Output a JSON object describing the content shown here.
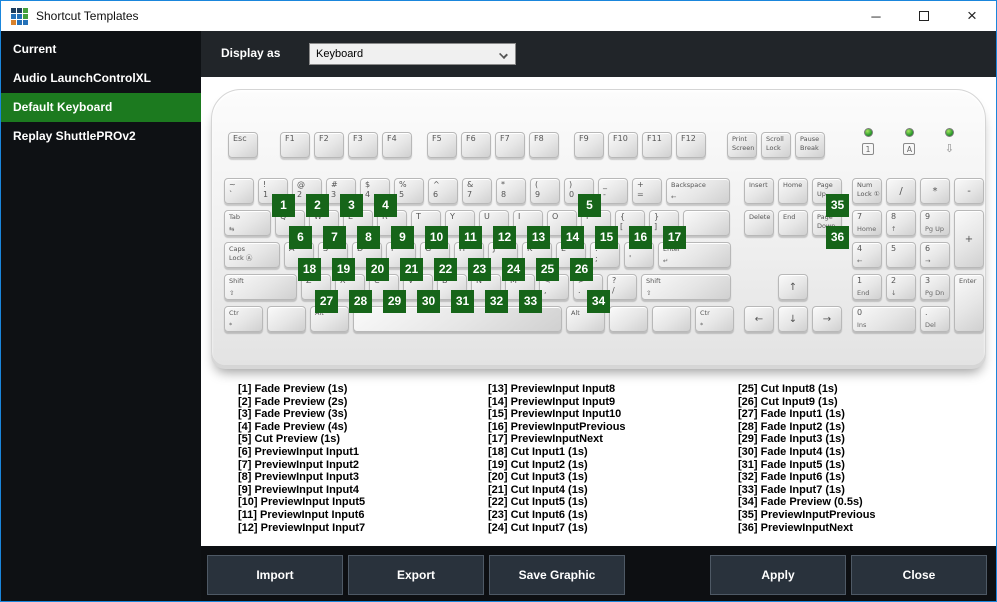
{
  "window": {
    "title": "Shortcut Templates",
    "icon_colors": [
      "#1d3e5f",
      "#1d3e5f",
      "#44a03c",
      "#2471b8",
      "#2471b8",
      "#44a03c",
      "#d9822b",
      "#2471b8",
      "#2471b8"
    ],
    "controls": {
      "minimize": "─",
      "close": "×"
    }
  },
  "colors": {
    "selection_green": "#1c7a1f",
    "badge_green": "#166519",
    "window_border": "#1a86dc"
  },
  "sidebar": {
    "items": [
      {
        "label": "Current",
        "selected": false
      },
      {
        "label": "Audio LaunchControlXL",
        "selected": false
      },
      {
        "label": "Default Keyboard",
        "selected": true
      },
      {
        "label": "Replay ShuttlePROv2",
        "selected": false
      }
    ]
  },
  "toolbar": {
    "display_as_label": "Display as",
    "display_as_value": "Keyboard"
  },
  "keyboard": {
    "function_row": [
      {
        "t": "Esc"
      },
      {
        "sp": 18
      },
      {
        "t": "F1"
      },
      {
        "t": "F2"
      },
      {
        "t": "F3"
      },
      {
        "t": "F4"
      },
      {
        "sp": 11
      },
      {
        "t": "F5"
      },
      {
        "t": "F6"
      },
      {
        "t": "F7"
      },
      {
        "t": "F8"
      },
      {
        "sp": 11
      },
      {
        "t": "F9"
      },
      {
        "t": "F10"
      },
      {
        "t": "F11"
      },
      {
        "t": "F12"
      },
      {
        "sp": 17
      },
      {
        "t": "Print",
        "b": "Screen",
        "cls": "sm"
      },
      {
        "t": "Scroll",
        "b": "Lock",
        "cls": "sm"
      },
      {
        "t": "Pause",
        "b": "Break",
        "cls": "sm"
      }
    ],
    "leds": [
      {
        "label": "1",
        "box": true,
        "name": "num-lock-led"
      },
      {
        "label": "A",
        "box": true,
        "name": "caps-lock-led"
      },
      {
        "label": "⇩",
        "box": false,
        "name": "scroll-lock-led"
      }
    ],
    "main_rows": [
      [
        {
          "t": "~",
          "b": "`"
        },
        {
          "t": "!",
          "b": "1",
          "badge": 1
        },
        {
          "t": "@",
          "b": "2",
          "badge": 2
        },
        {
          "t": "#",
          "b": "3",
          "badge": 3
        },
        {
          "t": "$",
          "b": "4",
          "badge": 4
        },
        {
          "t": "%",
          "b": "5"
        },
        {
          "t": "^",
          "b": "6"
        },
        {
          "t": "&",
          "b": "7"
        },
        {
          "t": "*",
          "b": "8"
        },
        {
          "t": "(",
          "b": "9"
        },
        {
          "t": ")",
          "b": "0",
          "badge": 5
        },
        {
          "t": "_",
          "b": "-"
        },
        {
          "t": "+",
          "b": "="
        },
        {
          "t": "Backspace",
          "s": "←",
          "w": 2,
          "cls": "sm"
        }
      ],
      [
        {
          "t": "Tab",
          "s": "⇆",
          "w": 1.5,
          "cls": "sm"
        },
        {
          "t": "Q",
          "badge": 6
        },
        {
          "t": "W",
          "badge": 7
        },
        {
          "t": "E",
          "badge": 8
        },
        {
          "t": "R",
          "badge": 9
        },
        {
          "t": "T",
          "badge": 10
        },
        {
          "t": "Y",
          "badge": 11
        },
        {
          "t": "U",
          "badge": 12
        },
        {
          "t": "I",
          "badge": 13
        },
        {
          "t": "O",
          "badge": 14
        },
        {
          "t": "P",
          "badge": 15
        },
        {
          "t": "{",
          "b": "[",
          "badge": 16
        },
        {
          "t": "}",
          "b": "]",
          "badge": 17
        },
        {
          "t": "",
          "w": 1.5
        }
      ],
      [
        {
          "t": "Caps",
          "b": "Lock Ⓐ",
          "w": 1.75,
          "cls": "sm"
        },
        {
          "t": "A",
          "badge": 18
        },
        {
          "t": "S",
          "badge": 19
        },
        {
          "t": "D",
          "badge": 20
        },
        {
          "t": "F",
          "badge": 21
        },
        {
          "t": "G",
          "badge": 22
        },
        {
          "t": "H",
          "badge": 23
        },
        {
          "t": "J",
          "badge": 24
        },
        {
          "t": "K",
          "badge": 25
        },
        {
          "t": "L",
          "badge": 26
        },
        {
          "t": ":",
          "b": ";"
        },
        {
          "t": "\"",
          "b": "'"
        },
        {
          "t": "Enter",
          "s": "↵",
          "w": 2.25,
          "cls": "sm"
        }
      ],
      [
        {
          "t": "Shift",
          "s": "⇧",
          "w": 2.25,
          "cls": "sm"
        },
        {
          "t": "Z",
          "badge": 27
        },
        {
          "t": "X",
          "badge": 28
        },
        {
          "t": "C",
          "badge": 29
        },
        {
          "t": "V",
          "badge": 30
        },
        {
          "t": "B",
          "badge": 31
        },
        {
          "t": "N",
          "badge": 32
        },
        {
          "t": "M",
          "badge": 33
        },
        {
          "t": "<",
          "b": ","
        },
        {
          "t": ">",
          "b": ".",
          "badge": 34
        },
        {
          "t": "?",
          "b": "/"
        },
        {
          "t": "Shift",
          "s": "⇧",
          "w": 2.75,
          "cls": "sm"
        }
      ],
      [
        {
          "t": "Ctr",
          "s": "*",
          "w": 1.25,
          "cls": "sm"
        },
        {
          "t": "",
          "w": 1.25
        },
        {
          "t": "Alt",
          "w": 1.25,
          "cls": "sm"
        },
        {
          "t": "",
          "w": 6.25,
          "n": "space"
        },
        {
          "t": "Alt",
          "w": 1.25,
          "cls": "sm"
        },
        {
          "t": "",
          "w": 1.25
        },
        {
          "t": "",
          "w": 1.25
        },
        {
          "t": "Ctr",
          "s": "*",
          "w": 1.25,
          "cls": "sm"
        }
      ]
    ],
    "nav": [
      {
        "t": "Insert",
        "c": 1,
        "r": 1,
        "cls": "sm"
      },
      {
        "t": "Home",
        "c": 2,
        "r": 1,
        "cls": "sm"
      },
      {
        "t": "Page",
        "b": "Up",
        "c": 3,
        "r": 1,
        "cls": "sm",
        "badge": 35
      },
      {
        "t": "Delete",
        "c": 1,
        "r": 2,
        "cls": "sm"
      },
      {
        "t": "End",
        "c": 2,
        "r": 2,
        "cls": "sm"
      },
      {
        "t": "Page",
        "b": "Down",
        "c": 3,
        "r": 2,
        "cls": "sm",
        "badge": 36
      },
      {
        "t": "↑",
        "c": 2,
        "r": 4,
        "ctr": true
      },
      {
        "t": "←",
        "c": 1,
        "r": 5,
        "ctr": true
      },
      {
        "t": "↓",
        "c": 2,
        "r": 5,
        "ctr": true
      },
      {
        "t": "→",
        "c": 3,
        "r": 5,
        "ctr": true
      }
    ],
    "numpad": [
      {
        "t": "Num",
        "b": "Lock ①",
        "c": 1,
        "r": 1,
        "cls": "sm"
      },
      {
        "t": "/",
        "c": 2,
        "r": 1,
        "ctr": true
      },
      {
        "t": "*",
        "c": 3,
        "r": 1,
        "ctr": true
      },
      {
        "t": "-",
        "c": 4,
        "r": 1,
        "ctr": true
      },
      {
        "t": "7",
        "s": "Home",
        "c": 1,
        "r": 2
      },
      {
        "t": "8",
        "s": "↑",
        "c": 2,
        "r": 2
      },
      {
        "t": "9",
        "s": "Pg Up",
        "c": 3,
        "r": 2
      },
      {
        "t": "+",
        "c": 4,
        "r": 2,
        "rs": 2,
        "ctr": true
      },
      {
        "t": "4",
        "s": "←",
        "c": 1,
        "r": 3
      },
      {
        "t": "5",
        "c": 2,
        "r": 3
      },
      {
        "t": "6",
        "s": "→",
        "c": 3,
        "r": 3
      },
      {
        "t": "1",
        "s": "End",
        "c": 1,
        "r": 4
      },
      {
        "t": "2",
        "s": "↓",
        "c": 2,
        "r": 4
      },
      {
        "t": "3",
        "s": "Pg Dn",
        "c": 3,
        "r": 4
      },
      {
        "t": "Enter",
        "c": 4,
        "r": 4,
        "rs": 2,
        "cls": "sm"
      },
      {
        "t": "0",
        "s": "Ins",
        "c": 1,
        "r": 5,
        "cs": 2
      },
      {
        "t": ".",
        "s": "Del",
        "c": 3,
        "r": 5
      }
    ]
  },
  "shortcuts": {
    "columns": [
      [
        "[1] Fade Preview (1s)",
        "[2] Fade Preview (2s)",
        "[3] Fade Preview (3s)",
        "[4] Fade Preview (4s)",
        "[5] Cut Preview (1s)",
        "[6] PreviewInput Input1",
        "[7] PreviewInput Input2",
        "[8] PreviewInput Input3",
        "[9] PreviewInput Input4",
        "[10] PreviewInput Input5",
        "[11] PreviewInput Input6",
        "[12] PreviewInput Input7"
      ],
      [
        "[13] PreviewInput Input8",
        "[14] PreviewInput Input9",
        "[15] PreviewInput Input10",
        "[16] PreviewInputPrevious",
        "[17] PreviewInputNext",
        "[18] Cut Input1 (1s)",
        "[19] Cut Input2 (1s)",
        "[20] Cut Input3 (1s)",
        "[21] Cut Input4 (1s)",
        "[22] Cut Input5 (1s)",
        "[23] Cut Input6 (1s)",
        "[24] Cut Input7 (1s)"
      ],
      [
        "[25] Cut Input8 (1s)",
        "[26] Cut Input9 (1s)",
        "[27] Fade Input1 (1s)",
        "[28] Fade Input2 (1s)",
        "[29] Fade Input3 (1s)",
        "[30] Fade Input4 (1s)",
        "[31] Fade Input5 (1s)",
        "[32] Fade Input6 (1s)",
        "[33] Fade Input7 (1s)",
        "[34] Fade Preview (0.5s)",
        "[35] PreviewInputPrevious",
        "[36] PreviewInputNext"
      ]
    ]
  },
  "footer": {
    "buttons": [
      "Import",
      "Export",
      "Save Graphic",
      "Apply",
      "Close"
    ]
  }
}
